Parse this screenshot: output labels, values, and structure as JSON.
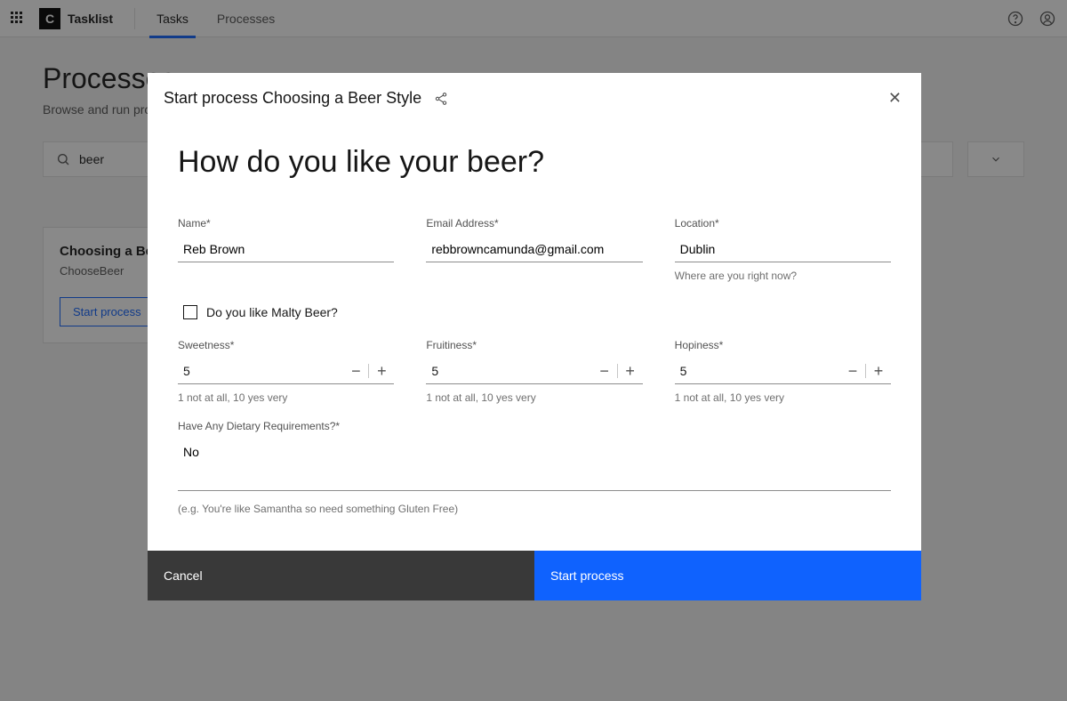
{
  "topbar": {
    "app_name": "Tasklist",
    "logo_letter": "C",
    "tabs": {
      "tasks": "Tasks",
      "processes": "Processes"
    }
  },
  "page": {
    "title": "Processes",
    "subtitle": "Browse and run processes.",
    "search_value": "beer"
  },
  "card": {
    "title": "Choosing a Beer",
    "subtitle": "ChooseBeer",
    "button": "Start process"
  },
  "modal": {
    "title": "Start process Choosing a Beer Style",
    "heading": "How do you like your beer?",
    "name": {
      "label": "Name*",
      "value": "Reb Brown"
    },
    "email": {
      "label": "Email Address*",
      "value": "rebbrowncamunda@gmail.com"
    },
    "location": {
      "label": "Location*",
      "value": "Dublin",
      "helper": "Where are you right now?"
    },
    "malty_checkbox": "Do you like Malty Beer?",
    "scale_helper": "1 not at all, 10 yes very",
    "sweetness": {
      "label": "Sweetness*",
      "value": "5"
    },
    "fruitiness": {
      "label": "Fruitiness*",
      "value": "5"
    },
    "hopiness": {
      "label": "Hopiness*",
      "value": "5"
    },
    "dietary": {
      "label": "Have Any Dietary Requirements?*",
      "value": "No",
      "helper": "(e.g. You're like Samantha so need something Gluten Free)"
    },
    "cancel": "Cancel",
    "start": "Start process"
  }
}
